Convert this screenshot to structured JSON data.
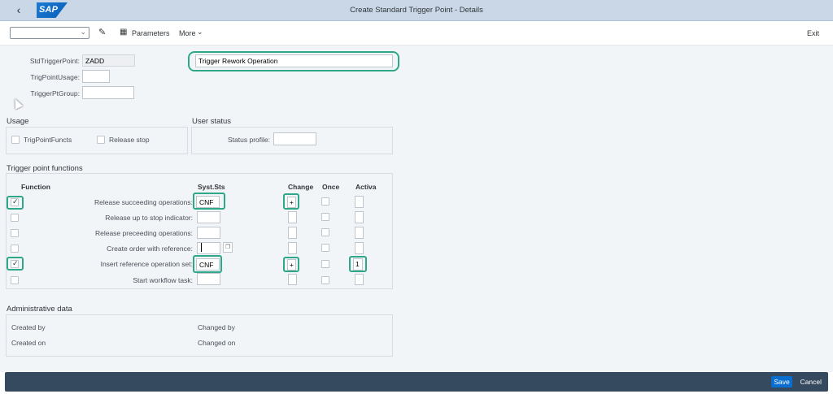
{
  "app": {
    "title": "Create Standard Trigger Point - Details",
    "logo_text": "SAP"
  },
  "toolbar": {
    "variant_value": "",
    "parameters_label": "Parameters",
    "more_label": "More",
    "exit_label": "Exit"
  },
  "header": {
    "std_trigger_point_label": "StdTriggerPoint:",
    "std_trigger_point_value": "ZADD",
    "trig_point_usage_label": "TrigPointUsage:",
    "trig_point_usage_value": "",
    "trigger_pt_group_label": "TriggerPtGroup:",
    "trigger_pt_group_value": "",
    "description_value": "Trigger Rework Operation"
  },
  "usage": {
    "title": "Usage",
    "trig_point_functs_label": "TrigPointFuncts",
    "trig_point_functs_checked": false,
    "release_stop_label": "Release stop",
    "release_stop_checked": false
  },
  "user_status": {
    "title": "User status",
    "status_profile_label": "Status profile:",
    "status_profile_value": ""
  },
  "trigger_functions": {
    "title": "Trigger point functions",
    "columns": {
      "function": "Function",
      "syst_sts": "Syst.Sts",
      "change": "Change",
      "once": "Once",
      "activa": "Activa"
    },
    "rows": [
      {
        "label": "Release succeeding operations:",
        "checked": true,
        "syst_sts": "CNF",
        "change": "+",
        "once": false,
        "activa": ""
      },
      {
        "label": "Release up to stop indicator:",
        "checked": false,
        "syst_sts": "",
        "change": "",
        "once": false,
        "activa": ""
      },
      {
        "label": "Release preceeding operations:",
        "checked": false,
        "syst_sts": "",
        "change": "",
        "once": false,
        "activa": ""
      },
      {
        "label": "Create order with reference:",
        "checked": false,
        "syst_sts": "",
        "change": "",
        "once": false,
        "activa": ""
      },
      {
        "label": "Insert reference operation set:",
        "checked": true,
        "syst_sts": "CNF",
        "change": "+",
        "once": false,
        "activa": "1"
      },
      {
        "label": "Start workflow task:",
        "checked": false,
        "syst_sts": "",
        "change": "",
        "once": false,
        "activa": ""
      }
    ]
  },
  "admin": {
    "title": "Administrative data",
    "created_by_label": "Created by",
    "created_on_label": "Created on",
    "changed_by_label": "Changed by",
    "changed_on_label": "Changed on"
  },
  "footer": {
    "save_label": "Save",
    "cancel_label": "Cancel"
  },
  "icons": {
    "back": "back-icon",
    "edit": "edit-icon",
    "parameters": "parameters-icon",
    "chevron": "chevron-down-icon",
    "value_help": "value-help-icon"
  },
  "colors": {
    "shell": "#c9d7e6",
    "highlight": "#2fa88a",
    "footer": "#354a5f",
    "accent": "#0a6ed1"
  }
}
